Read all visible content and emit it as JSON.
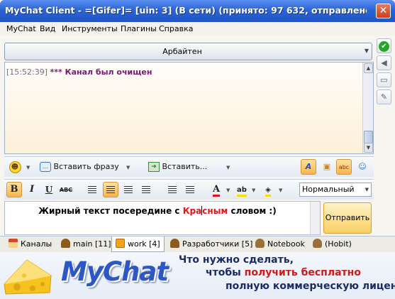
{
  "window": {
    "title": "MyChat Client - =[Gifer]= [uin: 3] (В сети) (принято: 97 632, отправлено: ...",
    "close_glyph": "✕"
  },
  "menu": [
    "MyChat",
    "Вид",
    "Инструменты",
    "Плагины",
    "Справка"
  ],
  "channel": {
    "name": "Арбайтен"
  },
  "chat": {
    "messages": [
      {
        "time": "[15:52:39]",
        "text": "*** Канал был очищен",
        "color": "#7b1775"
      }
    ]
  },
  "toolbar1": {
    "insert_phrase_label": "Вставить фразу",
    "insert_label": "Вставить..."
  },
  "toolbar2": {
    "bold": "B",
    "italic": "I",
    "underline": "U",
    "strike": "ABC",
    "font_color": "A",
    "style_value": "Нормальный"
  },
  "input": {
    "text_before": "Жирный текст посередине с ",
    "red_part_1": "Кра",
    "red_part_2": "сным",
    "text_after": " словом :)",
    "red_color": "#e21414"
  },
  "send_button": {
    "label": "Отправить"
  },
  "tabs": [
    {
      "label": "Каналы",
      "active": false
    },
    {
      "label": "main [11]",
      "active": false
    },
    {
      "label": "work [4]",
      "active": true
    },
    {
      "label": "Разработчики [5]",
      "active": false
    },
    {
      "label": "Notebook",
      "active": false
    },
    {
      "label": "(Hobit)",
      "active": false
    }
  ],
  "banner": {
    "logo": "MyChat",
    "line1": "Что нужно сделать,",
    "line2_before": "чтобы ",
    "line2_red": "получить бесплатно",
    "line3": "полную коммерческую лицензию"
  },
  "colors": {
    "titlebar": "#2c64d8",
    "accent_orange": "#f8b54a",
    "system_message": "#7b1775"
  }
}
